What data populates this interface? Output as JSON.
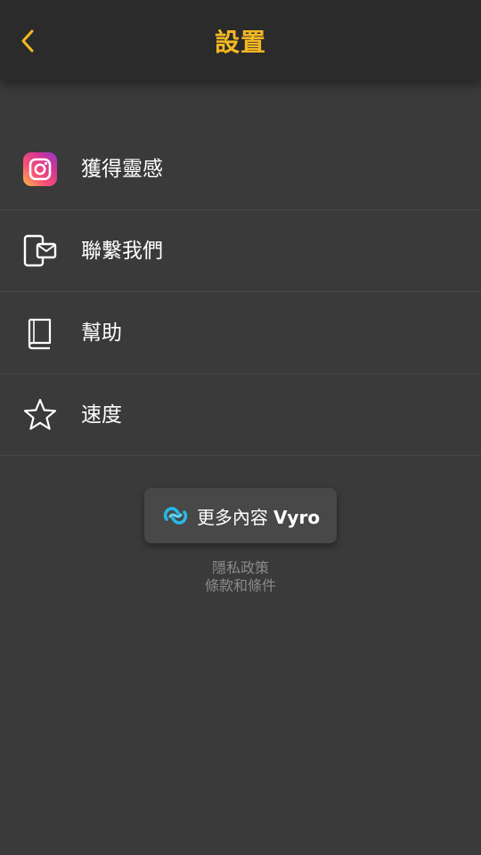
{
  "header": {
    "title": "設置",
    "accent_color": "#f5b822",
    "back_icon": "chevron-left-icon"
  },
  "menu": {
    "items": [
      {
        "label": "獲得靈感",
        "icon": "instagram-icon"
      },
      {
        "label": "聯繫我們",
        "icon": "phone-mail-icon"
      },
      {
        "label": "幫助",
        "icon": "book-icon"
      },
      {
        "label": "速度",
        "icon": "star-icon"
      }
    ]
  },
  "vyro": {
    "label": "更多內容",
    "brand": "Vyro",
    "icon": "vyro-logo-icon"
  },
  "footer": {
    "privacy_label": "隱私政策",
    "terms_label": "條款和條件"
  }
}
